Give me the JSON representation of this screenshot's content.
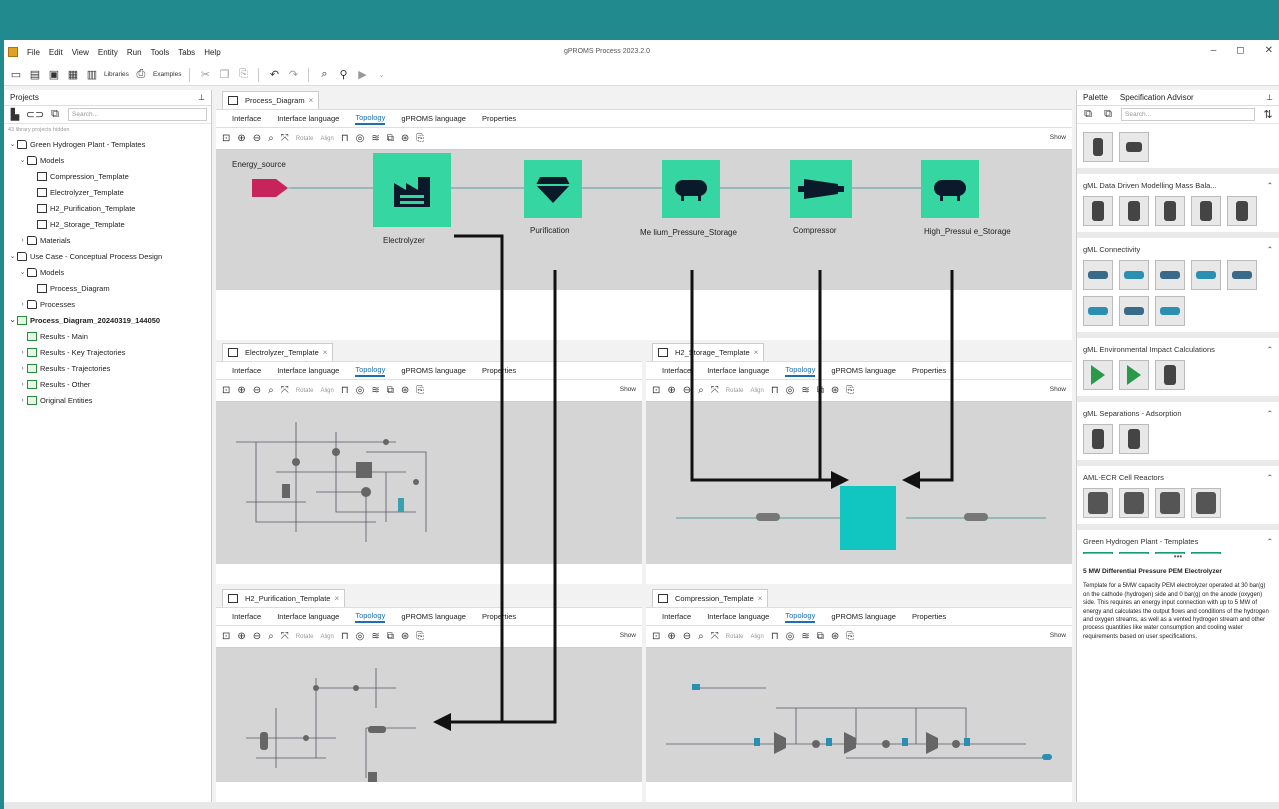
{
  "app": {
    "title": "gPROMS Process 2023.2.0",
    "window_controls": [
      "–",
      "◻",
      "✕"
    ]
  },
  "menu": [
    "File",
    "Edit",
    "View",
    "Entity",
    "Run",
    "Tools",
    "Tabs",
    "Help"
  ],
  "toolbar": {
    "libraries_label": "Libraries",
    "examples_label": "Examples"
  },
  "projects": {
    "title": "Projects",
    "search_placeholder": "Search...",
    "hidden_note": "43 library projects hidden",
    "tree": [
      {
        "label": "Green Hydrogen Plant - Templates",
        "indent": 0,
        "icon": "folder",
        "chev": "v",
        "bold": false
      },
      {
        "label": "Models",
        "indent": 1,
        "icon": "folder",
        "chev": "v",
        "bold": false
      },
      {
        "label": "Compression_Template",
        "indent": 2,
        "icon": "model",
        "chev": "",
        "bold": false
      },
      {
        "label": "Electrolyzer_Template",
        "indent": 2,
        "icon": "model",
        "chev": "",
        "bold": false
      },
      {
        "label": "H2_Purification_Template",
        "indent": 2,
        "icon": "model",
        "chev": "",
        "bold": false
      },
      {
        "label": "H2_Storage_Template",
        "indent": 2,
        "icon": "model",
        "chev": "",
        "bold": false
      },
      {
        "label": "Materials",
        "indent": 1,
        "icon": "folder",
        "chev": ">",
        "bold": false
      },
      {
        "label": "Use Case - Conceptual Process Design",
        "indent": 0,
        "icon": "folder",
        "chev": "v",
        "bold": false
      },
      {
        "label": "Models",
        "indent": 1,
        "icon": "folder",
        "chev": "v",
        "bold": false
      },
      {
        "label": "Process_Diagram",
        "indent": 2,
        "icon": "model",
        "chev": "",
        "bold": false
      },
      {
        "label": "Processes",
        "indent": 1,
        "icon": "folder",
        "chev": ">",
        "bold": false
      },
      {
        "label": "Process_Diagram_20240319_144050",
        "indent": 0,
        "icon": "res",
        "chev": "v",
        "bold": true
      },
      {
        "label": "Results - Main",
        "indent": 1,
        "icon": "res",
        "chev": "",
        "bold": false
      },
      {
        "label": "Results - Key Trajectories",
        "indent": 1,
        "icon": "res",
        "chev": ">",
        "bold": false
      },
      {
        "label": "Results - Trajectories",
        "indent": 1,
        "icon": "res",
        "chev": ">",
        "bold": false
      },
      {
        "label": "Results - Other",
        "indent": 1,
        "icon": "res",
        "chev": ">",
        "bold": false
      },
      {
        "label": "Original Entities",
        "indent": 1,
        "icon": "res",
        "chev": ">",
        "bold": false
      }
    ]
  },
  "view_tabs": [
    "Interface",
    "Interface language",
    "Topology",
    "gPROMS language",
    "Properties"
  ],
  "editor_toolbar": {
    "rotate": "Rotate",
    "align": "Align",
    "show": "Show"
  },
  "main_editor": {
    "tab": "Process_Diagram",
    "nodes": {
      "energy_source": "Energy_source",
      "electrolyzer": "Electrolyzer",
      "purification": "Purification",
      "medium_storage": "Me lium_Pressure_Storage",
      "compressor": "Compressor",
      "high_storage": "High_Pressui e_Storage"
    }
  },
  "sub_editors": {
    "electrolyzer": {
      "tab": "Electrolyzer_Template"
    },
    "storage": {
      "tab": "H2_Storage_Template"
    },
    "purification": {
      "tab": "H2_Purification_Template"
    },
    "compression": {
      "tab": "Compression_Template"
    }
  },
  "palette": {
    "tabs": [
      "Palette",
      "Specification Advisor"
    ],
    "search_placeholder": "Search...",
    "sections": [
      {
        "title": "gML Data Driven Modelling Mass Bala...",
        "count": 5
      },
      {
        "title": "gML Connectivity",
        "count": 8
      },
      {
        "title": "gML Environmental Impact Calculations",
        "count": 3
      },
      {
        "title": "gML Separations - Adsorption",
        "count": 2
      },
      {
        "title": "AML-ECR Cell Reactors",
        "count": 4
      },
      {
        "title": "Green Hydrogen Plant - Templates",
        "count": 4
      }
    ],
    "description_title": "5 MW Differential Pressure PEM Electrolyzer",
    "description": "Template for a 5MW capacity PEM electrolyzer operated at 30 bar(g) on the cathode (hydrogen) side and 0 bar(g) on the anode (oxygen) side. This requires an energy input connection with up to 5 MW of energy and calculates the output flows and conditions of the hydrogen and oxygen streams, as well as a vented hydrogen stream and other process quantities like water consumption and cooling water requirements based on user specifications.",
    "colors": {
      "accent": "#35d6a2",
      "flow_arrow": "#111111",
      "energy": "#c8245c",
      "placeholder_block": "#11c6c0"
    }
  }
}
